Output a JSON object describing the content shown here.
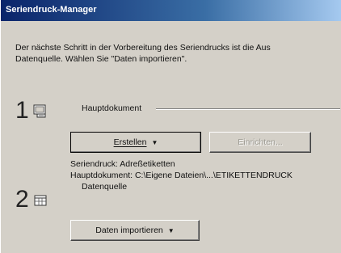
{
  "window": {
    "title": "Seriendruck-Manager"
  },
  "intro": {
    "line1": "Der nächste Schritt in der Vorbereitung des Seriendrucks ist die Aus",
    "line2": "Datenquelle. Wählen Sie \"Daten importieren\"."
  },
  "step1": {
    "number": "1",
    "icon": "main-document-icon",
    "label": "Hauptdokument",
    "create_button": "Erstellen",
    "edit_button": "Einrichten...",
    "info_line1": "Seriendruck: Adreßetiketten",
    "info_line2": "Hauptdokument: C:\\Eigene Dateien\\...\\ETIKETTENDRUCK"
  },
  "step2": {
    "number": "2",
    "icon": "data-source-icon",
    "label": "Datenquelle",
    "import_button": "Daten importieren"
  },
  "colors": {
    "face": "#d4d0c8",
    "title_start": "#0a246a",
    "title_end": "#a6caf0"
  }
}
